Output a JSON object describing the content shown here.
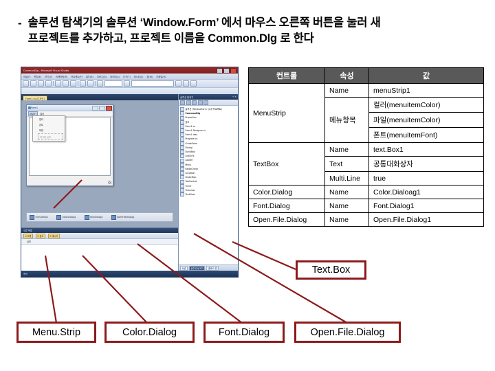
{
  "slide": {
    "bullet_marker": "-",
    "heading_line1": "솔루션 탐색기의 솔루션 ‘Window.Form’ 에서 마우스 오른쪽 버튼을 눌러 새",
    "heading_line2": "프로젝트를 추가하고, 프로젝트 이름을 Common.Dlg 로 한다"
  },
  "table": {
    "headers": [
      "컨트롤",
      "속성",
      "값"
    ],
    "rows": [
      {
        "control": "MenuStrip",
        "property": "Name",
        "value": "menuStrip1"
      },
      {
        "control": "",
        "property": "메뉴항목",
        "value": "컬러(menuitemColor)"
      },
      {
        "control": "",
        "property": "",
        "value": "파일(menuitemColor)"
      },
      {
        "control": "",
        "property": "",
        "value": "폰트(menuitemFont)"
      },
      {
        "control": "TextBox",
        "property": "Name",
        "value": "text.Box1"
      },
      {
        "control": "",
        "property": "Text",
        "value": "공통대화상자"
      },
      {
        "control": "",
        "property": "Multi.Line",
        "value": "true"
      },
      {
        "control": "Color.Dialog",
        "property": "Name",
        "value": "Color.Dialoag1"
      },
      {
        "control": "Font.Dialog",
        "property": "Name",
        "value": "Font.Dialog1"
      },
      {
        "control": "Open.File.Dialog",
        "property": "Name",
        "value": "Open.File.Dialog1"
      }
    ]
  },
  "callouts": {
    "textbox": "Text.Box",
    "menustrip": "Menu.Strip",
    "colordialog": "Color.Dialog",
    "fontdialog": "Font.Dialog",
    "openfiledialog": "Open.File.Dialog"
  },
  "colors": {
    "callout_border": "#8C1A1A",
    "table_header_bg": "#595959",
    "table_border": "#000000",
    "leader_line": "#8C1A1A"
  },
  "screenshot": {
    "window_title": "CommonDlg - Microsoft Visual Studio",
    "menus": [
      "파일(F)",
      "편집(E)",
      "보기(V)",
      "리팩터링(R)",
      "프로젝트(P)",
      "빌드(B)",
      "디버그(D)",
      "데이터(A)",
      "도구(T)",
      "테스트(S)",
      "창(W)",
      "도움말(H)"
    ],
    "document_tab": "Form1.cs [디자인]",
    "form": {
      "title": "Form1",
      "menu_items": [
        "파일(F)",
        "컬러",
        "폰트",
        "대화상자"
      ],
      "dropdown_items": [
        "컬러",
        "폰트",
        "파일"
      ],
      "dropdown_placeholder": "여기에 입력"
    },
    "tray_components": [
      "menuStrip1",
      "colorDialog1",
      "fontDialog1",
      "openFileDialog1"
    ],
    "solution_explorer": {
      "title": "솔루션 탐색기",
      "nodes": [
        "솔루션 'WindowForm' (2개 프로젝트)",
        "CommonDlg",
        "Properties",
        "참조",
        "Form1.cs",
        "Form1.Designer.cs",
        "Form1.resx",
        "Program.cs",
        "GuideForm",
        "Dialog",
        "DynaBox",
        "ListCtrls",
        "Loader",
        "Menu",
        "RadioCheck",
        "Scrollbar",
        "StaticMap",
        "TabControl",
        "Timer",
        "Treeview",
        "TextView"
      ],
      "tabs": [
        "속성",
        "솔루션 탐색기",
        "클래스 뷰"
      ]
    },
    "error_list": {
      "title": "오류 목록",
      "filters": [
        "0 오류",
        "0 경고",
        "0 메시지"
      ],
      "column": "설명"
    },
    "status": "준비"
  }
}
